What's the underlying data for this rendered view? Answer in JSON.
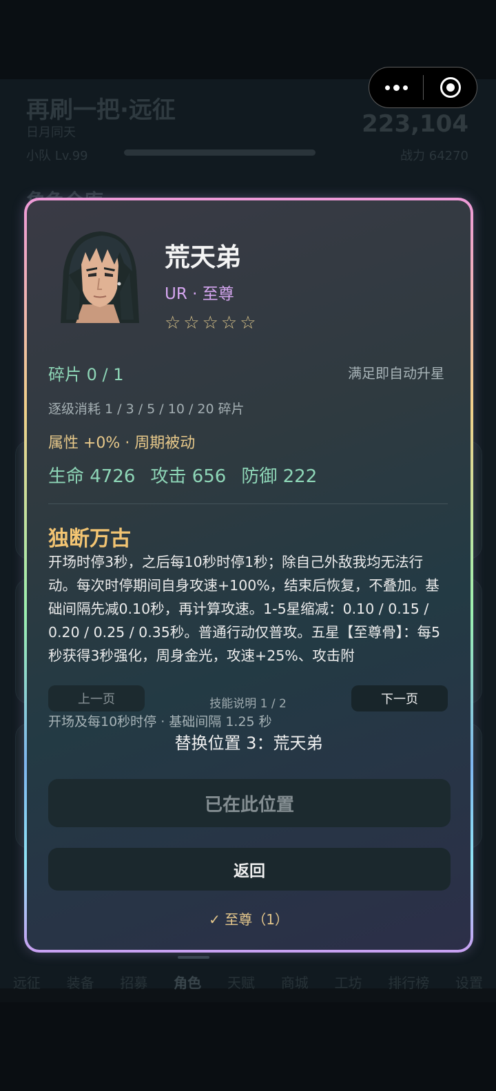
{
  "background": {
    "title": "再刷一把·远征",
    "subtitle": "日月同天",
    "team_level": "小队 Lv.99",
    "gold": "223,104",
    "power": "战力 64270",
    "section_title": "角色仓库",
    "nav": [
      "远征",
      "装备",
      "招募",
      "角色",
      "天赋",
      "商城",
      "工坊",
      "排行榜",
      "设置"
    ],
    "nav_active": "角色"
  },
  "capsule": {
    "more_icon": "more-dots-icon",
    "close_icon": "close-target-icon"
  },
  "hero": {
    "name": "荒天弟",
    "rarity": "UR · 至尊",
    "stars": "☆☆☆☆☆",
    "star_count": 0,
    "star_max": 5,
    "fragments": "碎片 0 / 1",
    "auto_upgrade": "满足即自动升星",
    "upgrade_cost": "逐级消耗 1 / 3 / 5 / 10 / 20 碎片",
    "attribute": "属性 +0% · 周期被动",
    "stats": {
      "hp": "生命 4726",
      "atk": "攻击 656",
      "def": "防御 222"
    }
  },
  "skill": {
    "name": "独断万古",
    "description": "开场时停3秒，之后每10秒时停1秒；除自己外敌我均无法行动。每次时停期间自身攻速+100%，结束后恢复，不叠加。基础间隔先减0.10秒，再计算攻速。1-5星缩减：0.10 / 0.15 / 0.20 / 0.25 / 0.35秒。普通行动仅普攻。五星【至尊骨】：每5秒获得3秒强化，周身金光，攻速+25%、攻击附",
    "prev_label": "上一页",
    "next_label": "下一页",
    "page_indicator": "技能说明 1 / 2",
    "interval_note": "开场及每10秒时停 · 基础间隔 1.25 秒"
  },
  "actions": {
    "replace_text": "替换位置 3：荒天弟",
    "in_place_label": "已在此位置",
    "back_label": "返回",
    "equipped_text": "✓ 至尊（1）"
  },
  "colors": {
    "accent_gold": "#f2c472",
    "stat_green": "#8ed6b7",
    "rarity_purple": "#d7a7f2"
  }
}
